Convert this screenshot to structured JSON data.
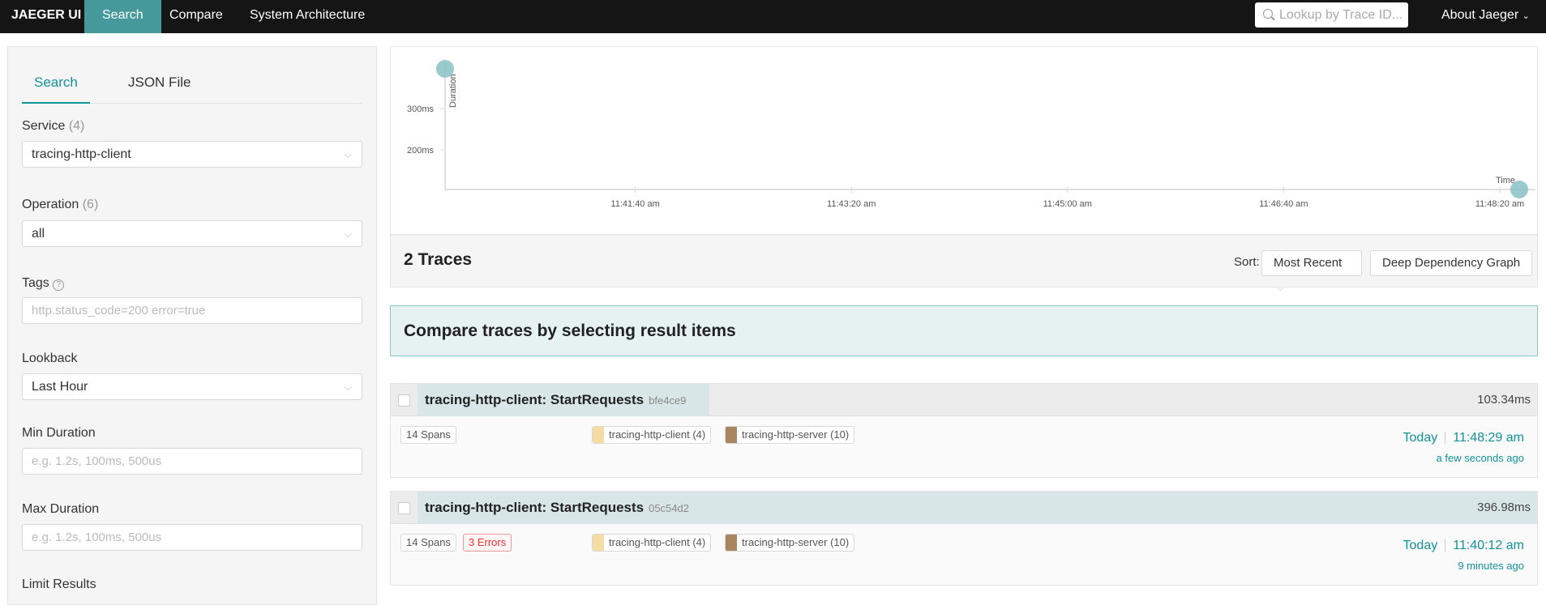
{
  "nav": {
    "brand": "JAEGER UI",
    "items": [
      "Search",
      "Compare",
      "System Architecture"
    ],
    "lookup_placeholder": "Lookup by Trace ID...",
    "about": "About Jaeger"
  },
  "search": {
    "tabs": [
      "Search",
      "JSON File"
    ],
    "service": {
      "label": "Service",
      "count": "(4)",
      "value": "tracing-http-client"
    },
    "operation": {
      "label": "Operation",
      "count": "(6)",
      "value": "all"
    },
    "tags": {
      "label": "Tags",
      "placeholder": "http.status_code=200 error=true"
    },
    "lookback": {
      "label": "Lookback",
      "value": "Last Hour"
    },
    "min_duration": {
      "label": "Min Duration",
      "placeholder": "e.g. 1.2s, 100ms, 500us"
    },
    "max_duration": {
      "label": "Max Duration",
      "placeholder": "e.g. 1.2s, 100ms, 500us"
    },
    "limit": {
      "label": "Limit Results"
    }
  },
  "chart_data": {
    "type": "scatter",
    "xlabel": "Time",
    "ylabel": "Duration",
    "xticks": [
      "11:41:40 am",
      "11:43:20 am",
      "11:45:00 am",
      "11:46:40 am",
      "11:48:20 am"
    ],
    "xtick_seconds": [
      42100,
      42200,
      42300,
      42400,
      42500
    ],
    "yticks": [
      "200ms",
      "300ms"
    ],
    "ytick_values": [
      200,
      300
    ],
    "xlim_seconds": [
      42012,
      42509
    ],
    "ylim": [
      103.34,
      396.98
    ],
    "points": [
      {
        "time": "11:40:12 am",
        "t": 42012,
        "duration_ms": 396.98
      },
      {
        "time": "11:48:29 am",
        "t": 42509,
        "duration_ms": 103.34
      }
    ],
    "color": "#8ec5c9"
  },
  "results": {
    "count_label": "2 Traces",
    "sort_label": "Sort:",
    "sort_value": "Most Recent",
    "deep_graph": "Deep Dependency Graph",
    "compare_banner": "Compare traces by selecting result items"
  },
  "traces": [
    {
      "name": "tracing-http-client: StartRequests",
      "id": "bfe4ce9",
      "duration": "103.34ms",
      "spans": "14 Spans",
      "services": [
        {
          "name": "tracing-http-client (4)",
          "color": "#f5dca4"
        },
        {
          "name": "tracing-http-server (10)",
          "color": "#a98560"
        }
      ],
      "day": "Today",
      "time": "11:48:29 am",
      "ago": "a few seconds ago"
    },
    {
      "name": "tracing-http-client: StartRequests",
      "id": "05c54d2",
      "duration": "396.98ms",
      "spans": "14 Spans",
      "errors": "3 Errors",
      "services": [
        {
          "name": "tracing-http-client (4)",
          "color": "#f5dca4"
        },
        {
          "name": "tracing-http-server (10)",
          "color": "#a98560"
        }
      ],
      "day": "Today",
      "time": "11:40:12 am",
      "ago": "9 minutes ago"
    }
  ]
}
